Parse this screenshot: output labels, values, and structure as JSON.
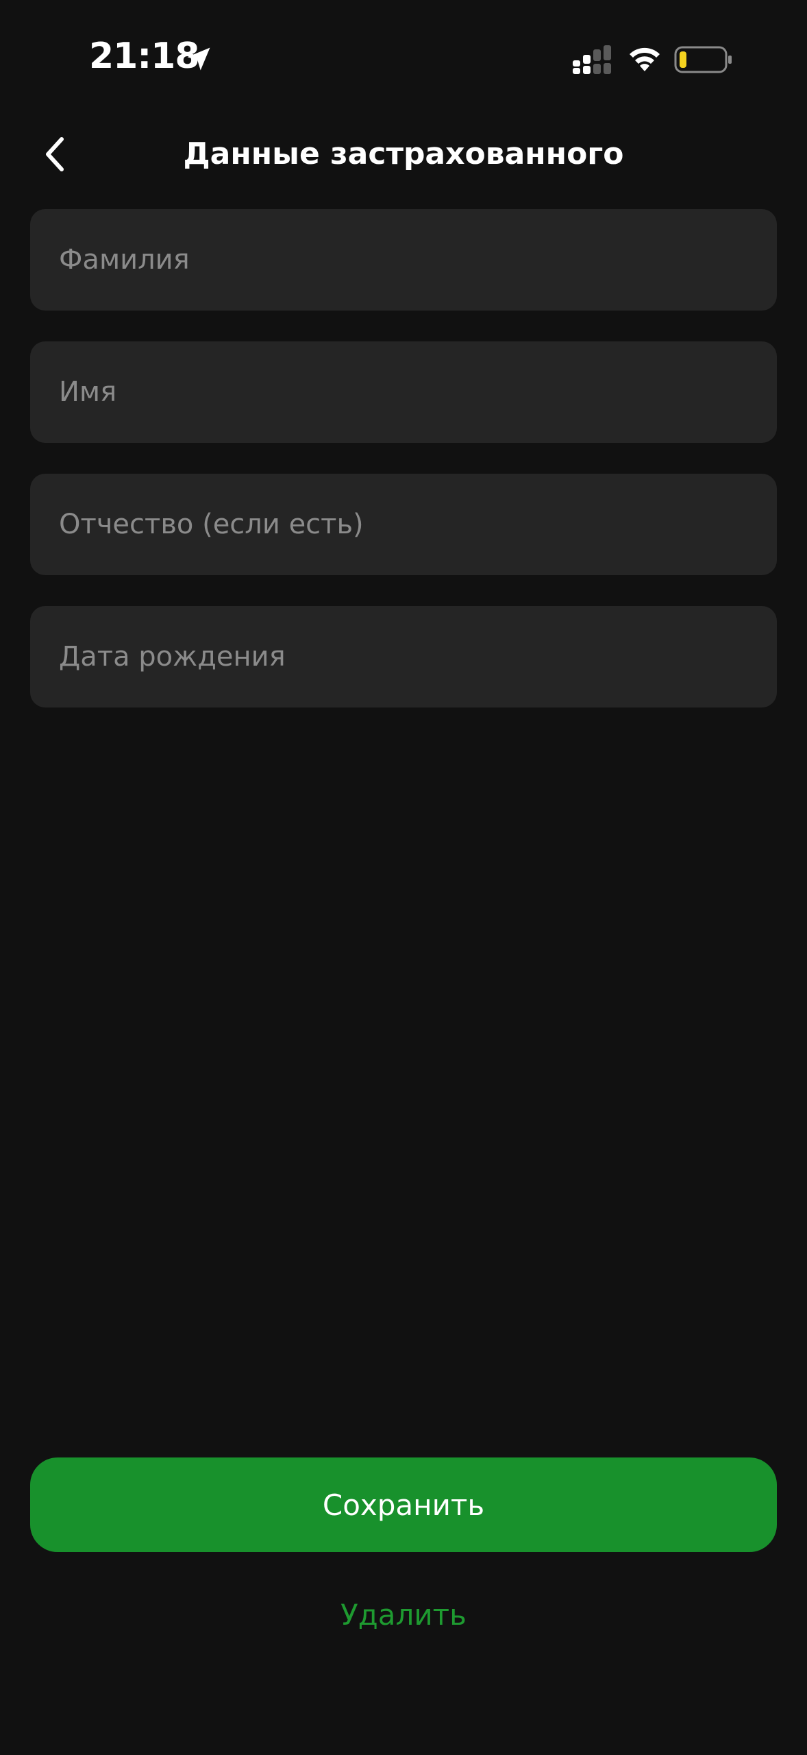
{
  "status_bar": {
    "time": "21:18",
    "battery_color": "#f4d21f",
    "icons": [
      "location-arrow-icon",
      "cellular-signal-icon",
      "wifi-icon",
      "battery-icon"
    ]
  },
  "header": {
    "title": "Данные застрахованного",
    "back_icon": "chevron-left-icon"
  },
  "form": {
    "surname": {
      "placeholder": "Фамилия",
      "value": ""
    },
    "name": {
      "placeholder": "Имя",
      "value": ""
    },
    "patronymic": {
      "placeholder": "Отчество (если есть)",
      "value": ""
    },
    "birth_date": {
      "placeholder": "Дата рождения",
      "value": ""
    }
  },
  "actions": {
    "save_label": "Сохранить",
    "delete_label": "Удалить"
  },
  "colors": {
    "background": "#111111",
    "field_background": "#252525",
    "placeholder": "#8b8b8b",
    "accent": "#18912c",
    "link": "#1e9a30"
  }
}
